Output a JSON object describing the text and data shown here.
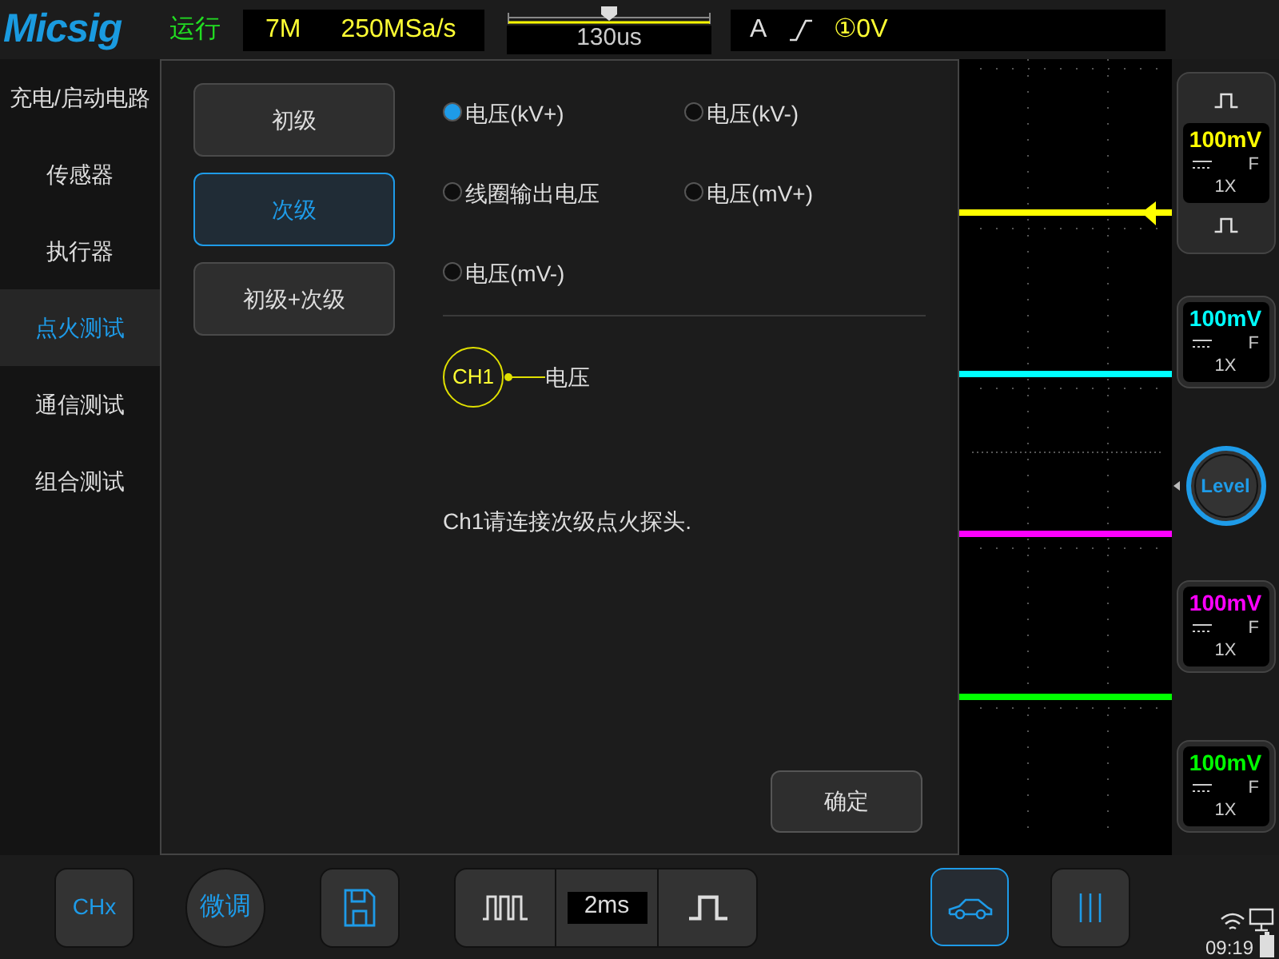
{
  "header": {
    "logo": "Micsig",
    "run_state": "运行",
    "memory": "7M",
    "sample_rate": "250MSa/s",
    "timebase": "130us",
    "trigger_source": "A",
    "trigger_level": "①0V"
  },
  "sidebar": {
    "items": [
      {
        "label": "充电/启动电路",
        "selected": false
      },
      {
        "label": "传感器",
        "selected": false
      },
      {
        "label": "执行器",
        "selected": false
      },
      {
        "label": "点火测试",
        "selected": true
      },
      {
        "label": "通信测试",
        "selected": false
      },
      {
        "label": "组合测试",
        "selected": false
      }
    ]
  },
  "modes": [
    {
      "label": "初级",
      "selected": false
    },
    {
      "label": "次级",
      "selected": true
    },
    {
      "label": "初级+次级",
      "selected": false
    }
  ],
  "options": [
    {
      "label": "电压(kV+)",
      "selected": true
    },
    {
      "label": "电压(kV-)",
      "selected": false
    },
    {
      "label": "线圈输出电压",
      "selected": false
    },
    {
      "label": "电压(mV+)",
      "selected": false
    },
    {
      "label": "电压(mV-)",
      "selected": false
    }
  ],
  "probe": {
    "channel": "CH1",
    "signal": "电压"
  },
  "message": "Ch1请连接次级点火探头.",
  "confirm_button": "确定",
  "channels": [
    {
      "scale": "100mV",
      "coupling": "F",
      "probe": "1X",
      "color": "#ffff00"
    },
    {
      "scale": "100mV",
      "coupling": "F",
      "probe": "1X",
      "color": "#00ffff"
    },
    {
      "scale": "100mV",
      "coupling": "F",
      "probe": "1X",
      "color": "#ff00ff"
    },
    {
      "scale": "100mV",
      "coupling": "F",
      "probe": "1X",
      "color": "#00ff00"
    }
  ],
  "level_button": "Level",
  "bottom_bar": {
    "channel_button": "CHx",
    "fine_button": "微调",
    "time_scale": "2ms",
    "auto_selected": true
  },
  "status": {
    "time": "09:19"
  }
}
